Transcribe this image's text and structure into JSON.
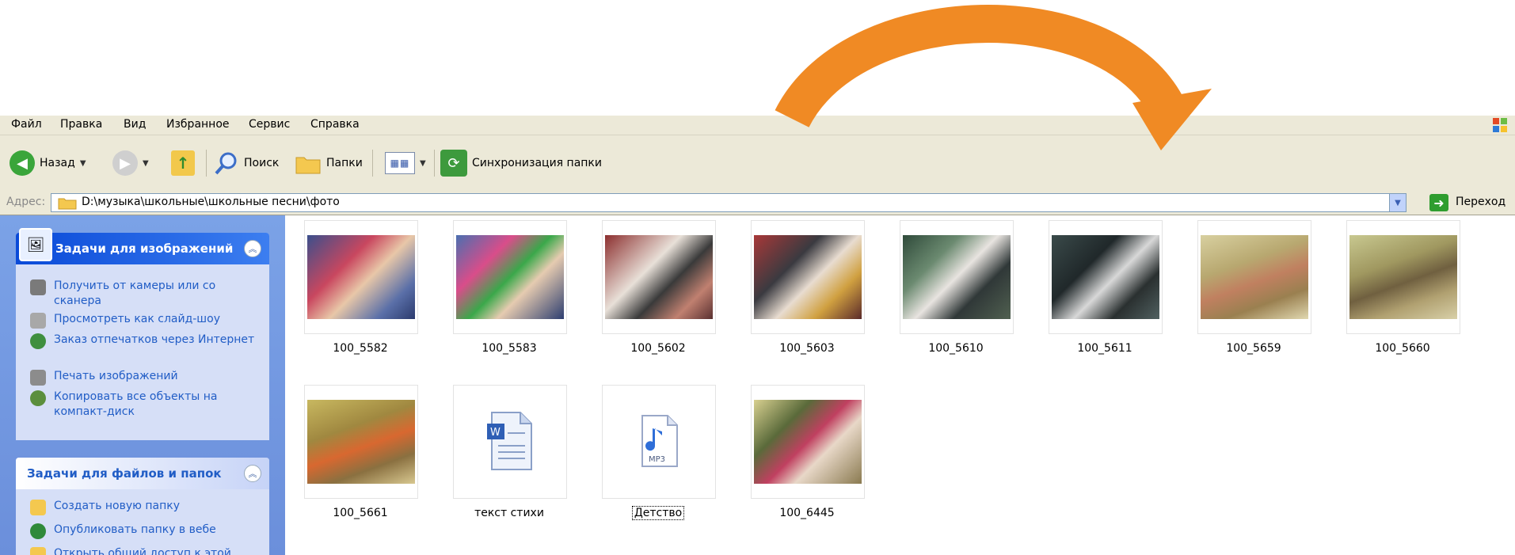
{
  "menu": [
    "Файл",
    "Правка",
    "Вид",
    "Избранное",
    "Сервис",
    "Справка"
  ],
  "toolbar": {
    "back": "Назад",
    "search": "Поиск",
    "folders": "Папки",
    "sync": "Синхронизация папки"
  },
  "address": {
    "label": "Адрес:",
    "path": "D:\\музыка\\школьные\\школьные песни\\фото",
    "go": "Переход"
  },
  "left_panel": {
    "image_tasks": {
      "title": "Задачи для изображений",
      "items": [
        "Получить от камеры или со сканера",
        "Просмотреть как слайд-шоу",
        "Заказ отпечатков через Интернет",
        "Печать изображений",
        "Копировать все объекты на компакт-диск"
      ]
    },
    "file_tasks": {
      "title": "Задачи для файлов и папок",
      "items": [
        "Создать новую папку",
        "Опубликовать папку в вебе",
        "Открыть общий доступ к этой папке"
      ]
    }
  },
  "files": [
    {
      "name": "100_5582",
      "type": "photo"
    },
    {
      "name": "100_5583",
      "type": "photo"
    },
    {
      "name": "100_5602",
      "type": "photo"
    },
    {
      "name": "100_5603",
      "type": "photo"
    },
    {
      "name": "100_5610",
      "type": "photo"
    },
    {
      "name": "100_5611",
      "type": "photo"
    },
    {
      "name": "100_5659",
      "type": "photo"
    },
    {
      "name": "100_5660",
      "type": "photo"
    },
    {
      "name": "100_5661",
      "type": "photo"
    },
    {
      "name": "текст стихи",
      "type": "word-document-icon"
    },
    {
      "name": "Детство",
      "type": "mp3-file-icon",
      "selected": true
    },
    {
      "name": "100_6445",
      "type": "photo"
    }
  ],
  "colors": {
    "arrow": "#f08a24",
    "link": "#215dc6",
    "panel_bg": "#6b8fdb"
  }
}
